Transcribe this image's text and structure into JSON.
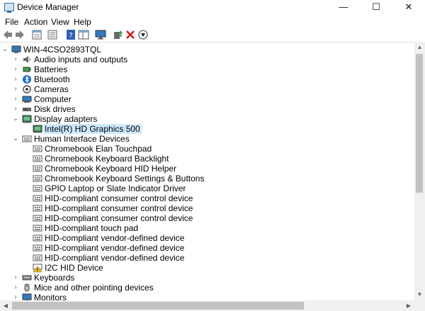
{
  "window": {
    "title": "Device Manager",
    "minimize": "—",
    "maximize": "☐",
    "close": "✕"
  },
  "menu": [
    "File",
    "Action",
    "View",
    "Help"
  ],
  "toolbar": [
    "back-icon",
    "forward-icon",
    "properties-sheet-icon",
    "show-hidden-icon",
    "help-icon",
    "details-pane-icon",
    "monitor-icon",
    "update-driver-icon",
    "uninstall-icon",
    "scan-hardware-icon"
  ],
  "tree": {
    "root": "WIN-4CSO2893TQL",
    "categories": [
      {
        "label": "Audio inputs and outputs",
        "icon": "speaker-icon",
        "expanded": false,
        "children": []
      },
      {
        "label": "Batteries",
        "icon": "battery-icon",
        "expanded": false,
        "children": []
      },
      {
        "label": "Bluetooth",
        "icon": "bluetooth-icon",
        "expanded": false,
        "children": []
      },
      {
        "label": "Cameras",
        "icon": "camera-icon",
        "expanded": false,
        "children": []
      },
      {
        "label": "Computer",
        "icon": "computer-icon",
        "expanded": false,
        "children": []
      },
      {
        "label": "Disk drives",
        "icon": "disk-drive-icon",
        "expanded": false,
        "children": []
      },
      {
        "label": "Display adapters",
        "icon": "display-adapter-icon",
        "expanded": true,
        "children": [
          {
            "label": "Intel(R) HD Graphics 500",
            "icon": "display-adapter-icon",
            "selected": true
          }
        ]
      },
      {
        "label": "Human Interface Devices",
        "icon": "hid-icon",
        "expanded": true,
        "children": [
          {
            "label": "Chromebook Elan Touchpad",
            "icon": "hid-icon"
          },
          {
            "label": "Chromebook Keyboard Backlight",
            "icon": "hid-icon"
          },
          {
            "label": "Chromebook Keyboard HID Helper",
            "icon": "hid-icon"
          },
          {
            "label": "Chromebook Keyboard Settings & Buttons",
            "icon": "hid-icon"
          },
          {
            "label": "GPIO Laptop or Slate Indicator Driver",
            "icon": "hid-icon"
          },
          {
            "label": "HID-compliant consumer control device",
            "icon": "hid-icon"
          },
          {
            "label": "HID-compliant consumer control device",
            "icon": "hid-icon"
          },
          {
            "label": "HID-compliant consumer control device",
            "icon": "hid-icon"
          },
          {
            "label": "HID-compliant touch pad",
            "icon": "hid-icon"
          },
          {
            "label": "HID-compliant vendor-defined device",
            "icon": "hid-icon"
          },
          {
            "label": "HID-compliant vendor-defined device",
            "icon": "hid-icon"
          },
          {
            "label": "HID-compliant vendor-defined device",
            "icon": "hid-icon"
          },
          {
            "label": "I2C HID Device",
            "icon": "hid-warning-icon"
          }
        ]
      },
      {
        "label": "Keyboards",
        "icon": "keyboard-icon",
        "expanded": false,
        "children": []
      },
      {
        "label": "Mice and other pointing devices",
        "icon": "mouse-icon",
        "expanded": false,
        "children": []
      },
      {
        "label": "Monitors",
        "icon": "monitor-icon",
        "expanded": false,
        "children": []
      }
    ]
  },
  "colors": {
    "selection": "#cce8ff",
    "accent": "#3a6ea5"
  }
}
